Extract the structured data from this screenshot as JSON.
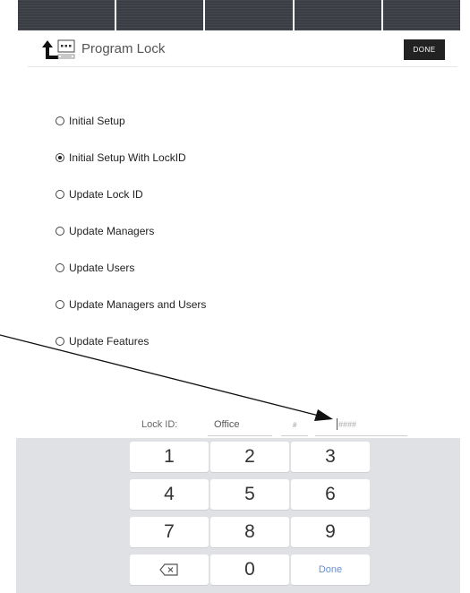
{
  "header": {
    "title": "Program Lock",
    "done_label": "DONE",
    "icon": "upload-lock-icon"
  },
  "options": [
    {
      "label": "Initial Setup",
      "selected": false
    },
    {
      "label": "Initial Setup With LockID",
      "selected": true
    },
    {
      "label": "Update Lock ID",
      "selected": false
    },
    {
      "label": "Update Managers",
      "selected": false
    },
    {
      "label": "Update Users",
      "selected": false
    },
    {
      "label": "Update Managers and Users",
      "selected": false
    },
    {
      "label": "Update Features",
      "selected": false
    }
  ],
  "lock_id": {
    "label": "Lock ID:",
    "name_value": "Office",
    "hash_label": "#",
    "number_placeholder": "####"
  },
  "keypad": {
    "keys": [
      "1",
      "2",
      "3",
      "4",
      "5",
      "6",
      "7",
      "8",
      "9",
      "",
      "0",
      "Done"
    ],
    "backspace_icon": "backspace-icon"
  },
  "colors": {
    "statusbar": "#3a3d44",
    "keypad_bg": "#dfe1e5",
    "done_key_text": "#6a8fcf"
  }
}
